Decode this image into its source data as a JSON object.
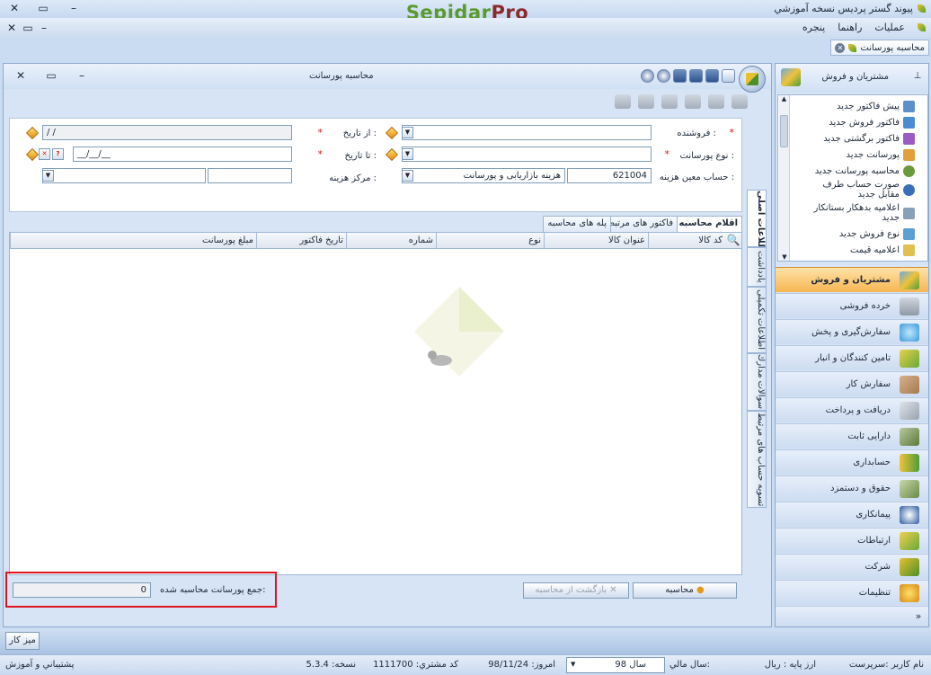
{
  "app": {
    "title": "پیوند گستر پردیس نسخه آموزشي",
    "logo_main": "Sepidar",
    "logo_suffix": "Pro"
  },
  "menu": {
    "items": [
      "عمليات",
      "راهنما",
      "پنجره"
    ]
  },
  "doc_tab": {
    "label": "محاسبه پورسانت"
  },
  "window": {
    "title": "محاسبه پورسانت"
  },
  "form": {
    "seller_label": "فروشنده :",
    "commission_type_label": "نوع پورسانت :",
    "account_label": "حساب معين هزينه :",
    "account_code": "621004",
    "account_name": "هزينه بازاريابی و پورسانت",
    "from_date_label": "از تاريخ :",
    "from_date_value": "/ /",
    "to_date_label": "تا تاريخ :",
    "to_date_value": "__/__/__",
    "cost_center_label": "مركز هزينه :",
    "required_mark": "*"
  },
  "grid_tabs": [
    "اقلام محاسبه",
    "فاكتور های مرتبط",
    "پله های محاسبه"
  ],
  "grid": {
    "columns": [
      "كد كالا",
      "عنوان كالا",
      "نوع",
      "شماره",
      "تاريخ فاكتور",
      "مبلغ پورسانت"
    ],
    "rows": []
  },
  "side_tabs": [
    "اطلاعات اصلی",
    "يادداشت",
    "اطلاعات تكميلی",
    "سوالات مدارك",
    "تسويه حساب های مرتبط"
  ],
  "bottom": {
    "calc_button": "محاسبه",
    "undo_button": "بازگشت از محاسبه",
    "total_label": "جمع پورسانت محاسبه شده:",
    "total_value": "0"
  },
  "right_panel": {
    "title": "مشتريان و فروش",
    "pin": "ꟷ",
    "shortcuts": [
      "پيش فاكتور جديد",
      "فاكتور فروش جديد",
      "فاكتور برگشتی جديد",
      "پورسانت جديد",
      "محاسبه پورسانت جديد",
      "صورت حساب طرف مقابل جديد",
      "اعلاميه بدهكار بستانكار جديد",
      "نوع فروش جديد",
      "اعلاميه قيمت"
    ],
    "modules": [
      "مشتريان و فروش",
      "خرده فروشی",
      "سفارش‌گيری و پخش",
      "تامين كنندگان و انبار",
      "سفارش كار",
      "دريافت و پرداخت",
      "دارايی ثابت",
      "حسابداری",
      "حقوق و دستمزد",
      "پيمانكاری",
      "ارتباطات",
      "شركت",
      "تنظيمات"
    ]
  },
  "taskbar": {
    "desk_button": "ميز كار"
  },
  "status": {
    "user": "نام كاربر :سرپرست",
    "base_currency": "ارز پايه :  ريال",
    "fiscal_label": "سال مالي:",
    "fiscal_value": "سال 98",
    "today": "امروز:  98/11/24",
    "customer_code": "كد مشتري:  1111700",
    "version": "نسخه:  5.3.4",
    "support": "پشتيباني و آموزش"
  },
  "colors": {
    "accent": "#f6b550",
    "frame": "#c9dcf2",
    "highlight_box": "#e0141e",
    "logo_green": "#5a9a2e",
    "logo_red": "#8b2a2a"
  }
}
